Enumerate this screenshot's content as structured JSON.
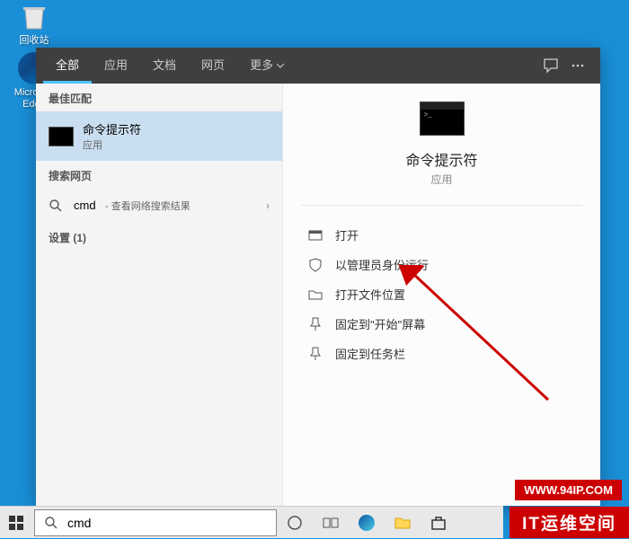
{
  "desktop": {
    "recycle_bin": "回收站",
    "edge": "Microsoft Edge"
  },
  "tabs": {
    "all": "全部",
    "apps": "应用",
    "docs": "文档",
    "web": "网页",
    "more": "更多"
  },
  "left": {
    "best_match": "最佳匹配",
    "cmd_title": "命令提示符",
    "cmd_sub": "应用",
    "search_web": "搜索网页",
    "web_cmd": "cmd",
    "web_cmd_sub": "- 查看网络搜索结果",
    "settings": "设置 (1)"
  },
  "detail": {
    "title": "命令提示符",
    "sub": "应用",
    "actions": {
      "open": "打开",
      "run_admin": "以管理员身份运行",
      "open_location": "打开文件位置",
      "pin_start": "固定到\"开始\"屏幕",
      "pin_taskbar": "固定到任务栏"
    }
  },
  "taskbar": {
    "search_value": "cmd"
  },
  "watermarks": {
    "w1": "WWW.94IP.COM",
    "w2": "IT运维空间"
  }
}
